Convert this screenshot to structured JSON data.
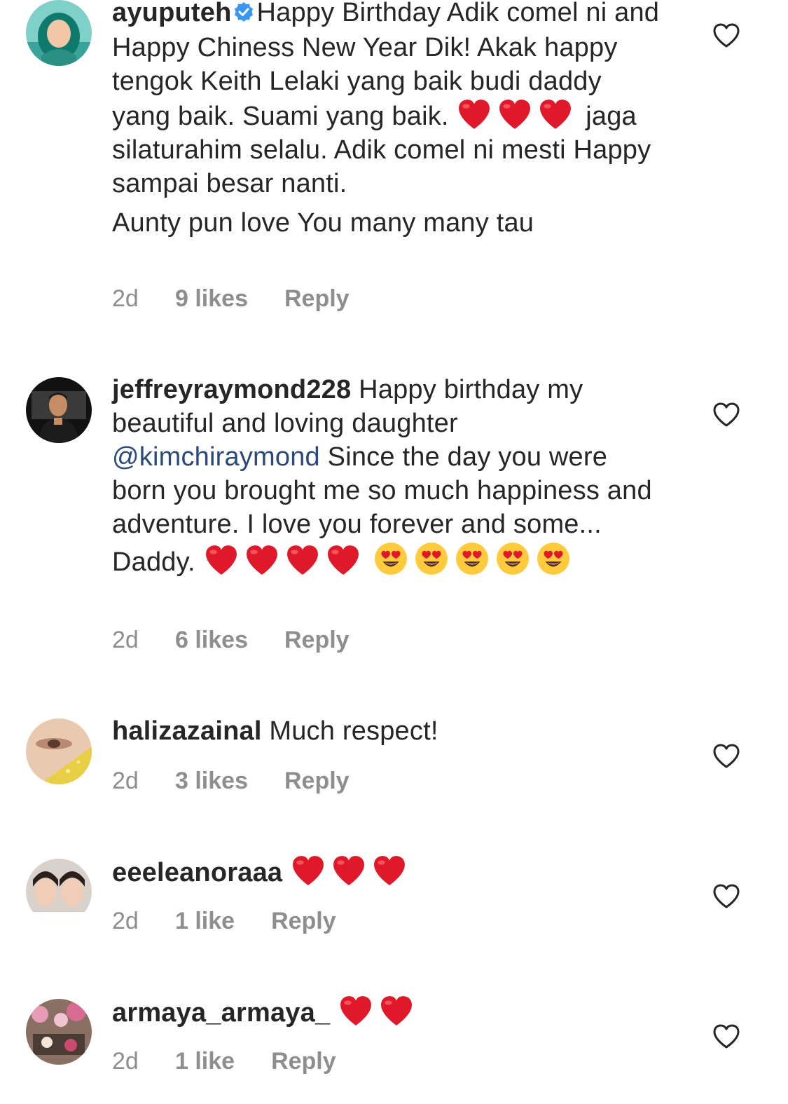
{
  "comments": [
    {
      "username": "ayuputeh",
      "verified": true,
      "text_1": "Happy Birthday Adik comel ni and Happy Chiness New Year Dik! Akak happy tengok Keith Lelaki yang baik budi daddy yang baik. Suami yang baik.",
      "text_2": "jaga silaturahim selalu. Adik comel ni mesti Happy sampai besar nanti.",
      "text_3": "Aunty pun love You many many tau",
      "time": "2d",
      "likes": "9 likes",
      "reply": "Reply"
    },
    {
      "username": "jeffreyraymond228",
      "text_1": "Happy birthday my beautiful and loving daughter",
      "mention": "@kimchiraymond",
      "text_2": " Since the day you were born you brought me so much happiness and adventure. I love you forever and some... Daddy.",
      "time": "2d",
      "likes": "6 likes",
      "reply": "Reply"
    },
    {
      "username": "halizazainal",
      "text_1": "Much respect!",
      "time": "2d",
      "likes": "3 likes",
      "reply": "Reply"
    },
    {
      "username": "eeeleanoraaa",
      "time": "2d",
      "likes": "1 like",
      "reply": "Reply"
    },
    {
      "username": "armaya_armaya_",
      "time": "2d",
      "likes": "1 like",
      "reply": "Reply"
    }
  ],
  "colors": {
    "text": "#262626",
    "meta": "#8e8e8e",
    "mention": "#2b4a7a",
    "verified": "#3897f0",
    "heart_emoji": "#e0192a"
  },
  "icons": [
    "verified-badge-icon",
    "red-heart-emoji",
    "heart-eyes-emoji",
    "like-heart-icon"
  ]
}
